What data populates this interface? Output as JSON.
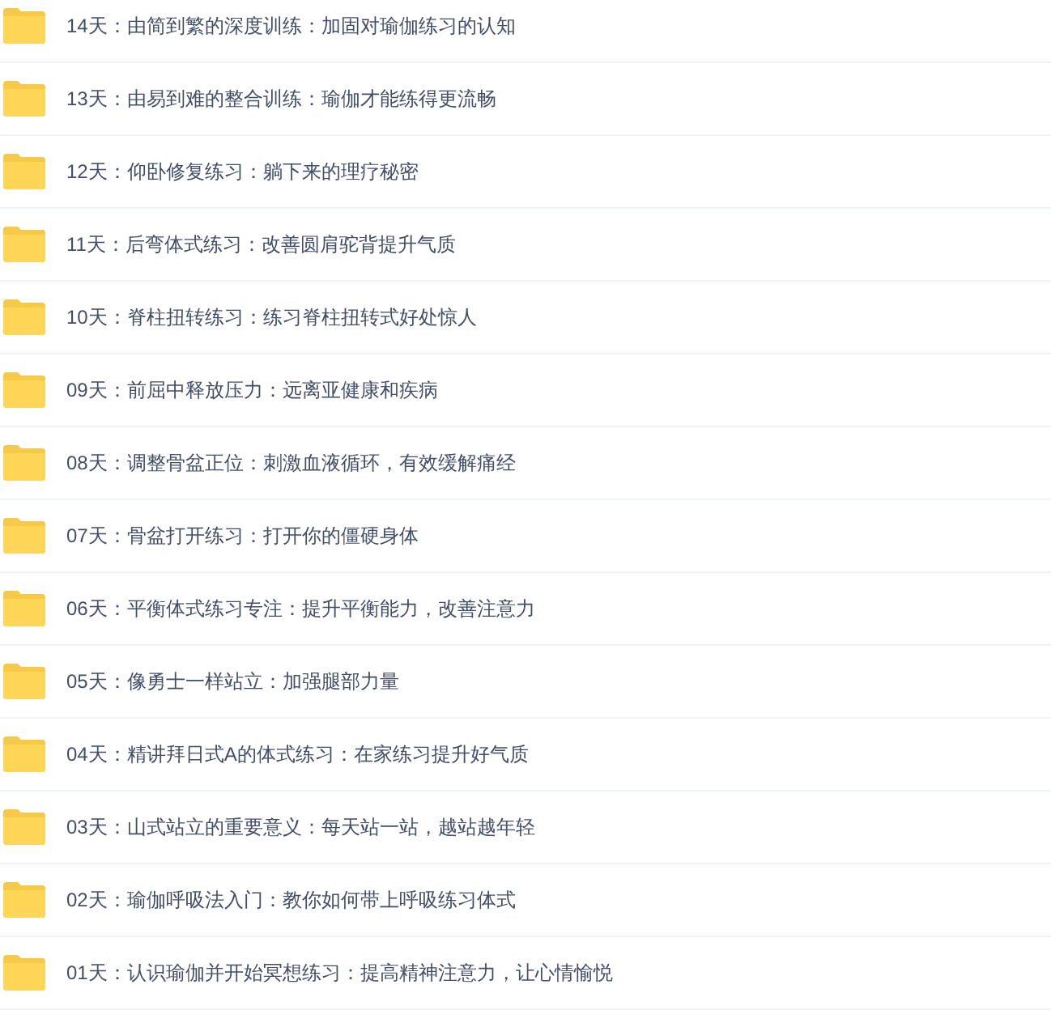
{
  "folders": [
    {
      "name": "14天：由简到繁的深度训练：加固对瑜伽练习的认知"
    },
    {
      "name": "13天：由易到难的整合训练：瑜伽才能练得更流畅"
    },
    {
      "name": "12天：仰卧修复练习：躺下来的理疗秘密"
    },
    {
      "name": "11天：后弯体式练习：改善圆肩驼背提升气质"
    },
    {
      "name": "10天：脊柱扭转练习：练习脊柱扭转式好处惊人"
    },
    {
      "name": "09天：前屈中释放压力：远离亚健康和疾病"
    },
    {
      "name": "08天：调整骨盆正位：刺激血液循环，有效缓解痛经"
    },
    {
      "name": "07天：骨盆打开练习：打开你的僵硬身体"
    },
    {
      "name": "06天：平衡体式练习专注：提升平衡能力，改善注意力"
    },
    {
      "name": "05天：像勇士一样站立：加强腿部力量"
    },
    {
      "name": "04天：精讲拜日式A的体式练习：在家练习提升好气质"
    },
    {
      "name": "03天：山式站立的重要意义：每天站一站，越站越年轻"
    },
    {
      "name": "02天：瑜伽呼吸法入门：教你如何带上呼吸练习体式"
    },
    {
      "name": "01天：认识瑜伽并开始冥想练习：提高精神注意力，让心情愉悦"
    }
  ]
}
